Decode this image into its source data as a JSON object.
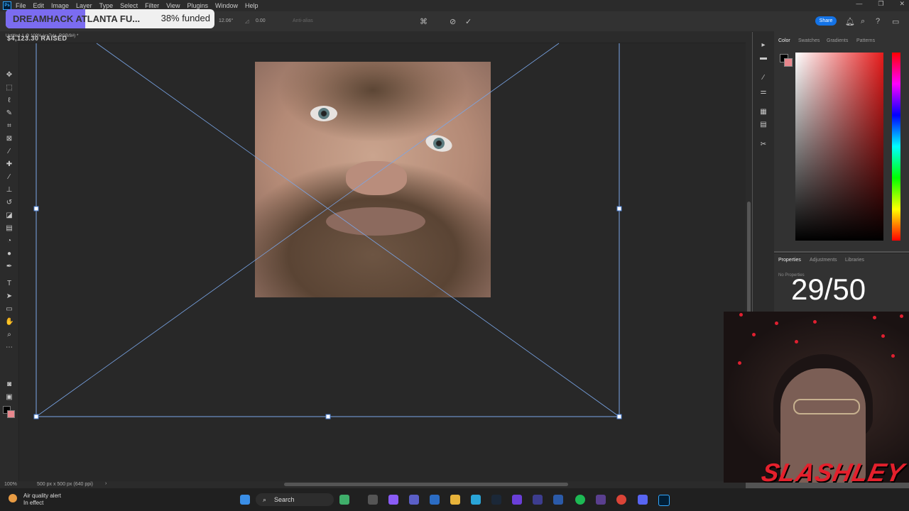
{
  "app": {
    "menus": [
      "File",
      "Edit",
      "Image",
      "Layer",
      "Type",
      "Select",
      "Filter",
      "View",
      "Plugins",
      "Window",
      "Help"
    ],
    "window_controls": [
      "—",
      "❐",
      "✕"
    ]
  },
  "options_bar": {
    "angle": "12.06°",
    "angle2": "0.00",
    "antialias": "Anti-alias",
    "share_label": "Share"
  },
  "document": {
    "tab_label": "Untitled-1 @ 100% (<x7xla, RGB/8#) *"
  },
  "overlay": {
    "raised": "$4,123.30 RAISED",
    "fund_title": "DREAMHACK ATLANTA FU...",
    "fund_pct_text": "38% funded",
    "fund_fraction": 0.38
  },
  "status": {
    "zoom": "100%",
    "doc_info": "500 px x 500 px (640 ppi)",
    "arrow": "›"
  },
  "panels": {
    "color_tabs": [
      "Color",
      "Swatches",
      "Gradients",
      "Patterns"
    ],
    "props_tabs": [
      "Properties",
      "Adjustments",
      "Libraries"
    ],
    "props_empty": "No Properties"
  },
  "counter": "29/50",
  "webcam": {
    "logo": "SLASHLEY"
  },
  "taskbar": {
    "weather_title": "Air quality alert",
    "weather_sub": "In effect",
    "search_label": "Search"
  },
  "colors": {
    "accent": "#1473e6",
    "fund_fill": "#7b6cf0",
    "bg_swatch": "#e8878d"
  }
}
